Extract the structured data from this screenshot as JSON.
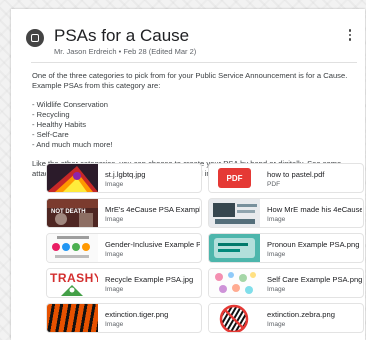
{
  "post": {
    "title": "PSAs for a Cause",
    "byline": "Mr. Jason Erdreich • Feb 28 (Edited Mar 2)",
    "paragraph1": "One of the three categories to pick from for your Public Service Announcement is for a Cause. Example PSAs from this category are:",
    "list": [
      "- Wildlife Conservation",
      "- Recycling",
      "- Healthy Habits",
      "- Self-Care",
      "- And much much more!"
    ],
    "paragraph2": "Like the other categories, you can choose to create your PSA by hand or digitally. See some attached examples linked to this post for ideas and inspiration!"
  },
  "attachments": [
    {
      "name": "st.j.lgbtq.jpg",
      "type": "Image",
      "icon": "image-thumbnail"
    },
    {
      "name": "how to pastel.pdf",
      "type": "PDF",
      "icon": "pdf-icon",
      "icon_label": "PDF"
    },
    {
      "name": "MrE's 4eCause PSA Example...",
      "type": "Image",
      "icon": "image-thumbnail",
      "thumb_text": "NOT DEATH"
    },
    {
      "name": "How MrE made his 4eCause ...",
      "type": "Image",
      "icon": "image-thumbnail"
    },
    {
      "name": "Gender-Inclusive Example P...",
      "type": "Image",
      "icon": "image-thumbnail"
    },
    {
      "name": "Pronoun Example PSA.png",
      "type": "Image",
      "icon": "image-thumbnail"
    },
    {
      "name": "Recycle Example PSA.jpg",
      "type": "Image",
      "icon": "image-thumbnail",
      "thumb_text": "TRASHY"
    },
    {
      "name": "Self Care Example PSA.png",
      "type": "Image",
      "icon": "image-thumbnail"
    },
    {
      "name": "extinction.tiger.png",
      "type": "Image",
      "icon": "image-thumbnail"
    },
    {
      "name": "extinction.zebra.png",
      "type": "Image",
      "icon": "image-thumbnail"
    }
  ],
  "colors": {
    "pdf_red": "#e53935",
    "trashy_red": "#d32f2f"
  }
}
